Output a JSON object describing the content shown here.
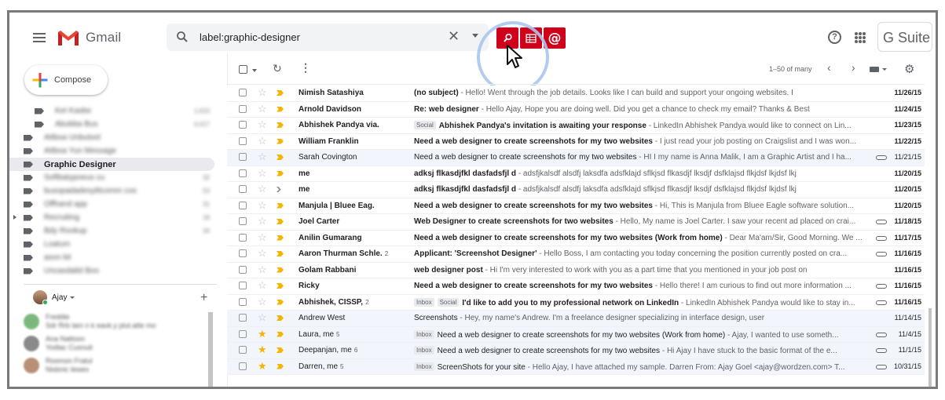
{
  "header": {
    "app_name": "Gmail",
    "search_query": "label:graphic-designer",
    "gsuite": "G Suite",
    "help": "?"
  },
  "sidebar": {
    "compose": "Compose",
    "labels": [
      {
        "name": "Ket Kasbe",
        "count": "1,610",
        "indent": 1
      },
      {
        "name": "Abubba Bus",
        "count": "4,417",
        "indent": 1
      },
      {
        "name": "Attboa Unbutool",
        "count": "",
        "indent": 0
      },
      {
        "name": "Attboa Yun Message",
        "count": "",
        "indent": 0
      },
      {
        "name": "Graphic Designer",
        "count": "",
        "indent": 0,
        "active": true
      },
      {
        "name": "Softbatypoeus cu",
        "count": "32",
        "indent": 0
      },
      {
        "name": "busopadadesylitcomm cos",
        "count": "53",
        "indent": 0
      },
      {
        "name": "Offhand app",
        "count": "31",
        "indent": 0
      },
      {
        "name": "Recruiting",
        "count": "18",
        "indent": 0,
        "expand": true
      },
      {
        "name": "Bdy Rookup",
        "count": "34",
        "indent": 0
      },
      {
        "name": "Loatum",
        "count": "",
        "indent": 0
      },
      {
        "name": "ason kit",
        "count": "",
        "indent": 0
      },
      {
        "name": "Uncasdalid Boo",
        "count": "",
        "indent": 0
      }
    ],
    "user": "Ajay",
    "hangouts": [
      {
        "l1": "Freddie",
        "l2": "Sdr Rrb lam n k eavk.y plut.atte mo",
        "color": "#7cb87e"
      },
      {
        "l1": "Ana Nattoon",
        "l2": "Yodlac Cusnuit",
        "color": "#8a8a8a"
      },
      {
        "l1": "Roomon Fratul",
        "l2": "Nisbnic lewes",
        "color": "#b89077"
      }
    ]
  },
  "toolbar": {
    "range": "1–50 of many"
  },
  "emails": [
    {
      "sender": "Nimish Satashiya",
      "n": "",
      "chips": [],
      "subject": "(no subject)",
      "preview": " - Hello! Went through the job details. Looks like I can build and support your ongoing websites. I",
      "date": "11/26/15",
      "unread": true,
      "starred": false,
      "important": true,
      "clip": false
    },
    {
      "sender": "Arnold Davidson",
      "n": "",
      "chips": [],
      "subject": "Re: web designer",
      "preview": " - Hello Ajay, Hope you are doing well. Did you get a chance to check my email? Thanks & Best",
      "date": "11/24/15",
      "unread": true,
      "starred": false,
      "important": true,
      "clip": false
    },
    {
      "sender": "Abhishek Pandya via.",
      "n": "",
      "chips": [
        "Social"
      ],
      "subject": "Abhishek Pandya's invitation is awaiting your response",
      "preview": " - LinkedIn Abhishek Pandya would like to connect on Lin...",
      "date": "11/23/15",
      "unread": true,
      "starred": false,
      "important": true,
      "clip": false
    },
    {
      "sender": "William Franklin",
      "n": "",
      "chips": [],
      "subject": "Need a web designer to create screenshots for my two websites",
      "preview": " - I just read your job posting on Craigslist and I was won...",
      "date": "11/22/15",
      "unread": true,
      "starred": false,
      "important": true,
      "clip": false
    },
    {
      "sender": "Sarah Covington",
      "n": "",
      "chips": [],
      "subject": "Need a web designer to create screenshots for my two websites",
      "preview": " - HI I my name is Anna Malik, I am a Graphic Artist and I ha...",
      "date": "11/21/15",
      "unread": false,
      "starred": false,
      "important": true,
      "clip": true
    },
    {
      "sender": "me",
      "n": "",
      "chips": [],
      "subject": "adksj flkasdjfkl dasfadsfjl d",
      "preview": " - adsfjkalsdf alsdfj laksdfa adsfklajd sflkjsd flkasdjf lksdjf dsfklajsd flkjdsf lkjdsf lkj",
      "date": "11/20/15",
      "unread": true,
      "starred": false,
      "important": true,
      "clip": false
    },
    {
      "sender": "me",
      "n": "",
      "chips": [],
      "subject": "adksj flkasdjfkl dasfadsfjl d",
      "preview": " - adsfjkalsdf alsdfj laksdfa adsfklajd sflkjsd flkasdjf lksdjf dsfklajsd flkjdsf lkjdsf lkj",
      "date": "11/20/15",
      "unread": true,
      "starred": false,
      "important": false,
      "clip": false
    },
    {
      "sender": "Manjula | Bluee Eag.",
      "n": "",
      "chips": [],
      "subject": "Need a web designer to create screenshots for my two websites",
      "preview": " - Hi, This is Manjula from Bluee Eagle software solution...",
      "date": "11/20/15",
      "unread": true,
      "starred": false,
      "important": true,
      "clip": false
    },
    {
      "sender": "Joel Carter",
      "n": "",
      "chips": [],
      "subject": "Web Designer to create screenshots for two websites",
      "preview": " - Hello, My name is Joel Carter. I saw your recent ad placed on crai...",
      "date": "11/18/15",
      "unread": true,
      "starred": false,
      "important": true,
      "clip": true
    },
    {
      "sender": "Anilin Gumarang",
      "n": "",
      "chips": [],
      "subject": "Need a web designer to create screenshots for my two websites (Work from home)",
      "preview": " - Dear Ma'am/Sir, Good Morning. We ...",
      "date": "11/17/15",
      "unread": true,
      "starred": false,
      "important": true,
      "clip": true
    },
    {
      "sender": "Aaron Thurman Schle.",
      "n": "2",
      "chips": [],
      "subject": "Applicant: 'Screenshot Designer'",
      "preview": " - Hello Boss, I am contacting you today concerning the position currently posted on cra...",
      "date": "11/16/15",
      "unread": true,
      "starred": false,
      "important": true,
      "clip": true
    },
    {
      "sender": "Golam Rabbani",
      "n": "",
      "chips": [],
      "subject": "web designer post",
      "preview": " - Hi I'm very interested to work with you as a part time that you mentioned in your job post on",
      "date": "11/16/15",
      "unread": true,
      "starred": false,
      "important": true,
      "clip": false
    },
    {
      "sender": "Ricky",
      "n": "",
      "chips": [],
      "subject": "Need a web designer to create screenshots for my two websites",
      "preview": " - Hello there! I am curious to find out more information ...",
      "date": "11/16/15",
      "unread": true,
      "starred": false,
      "important": true,
      "clip": true
    },
    {
      "sender": "Abhishek, CISSP,",
      "n": "2",
      "chips": [
        "Inbox",
        "Social"
      ],
      "subject": "I'd like to add you to my professional network on LinkedIn",
      "preview": " - LinkedIn Abhishek Pandya would like to stay in...",
      "date": "11/16/15",
      "unread": true,
      "starred": false,
      "important": true,
      "clip": true
    },
    {
      "sender": "Andrew West",
      "n": "",
      "chips": [],
      "subject": "Screenshots",
      "preview": " - Hey, my name's Andrew. I'm a freelance designer specializing in interface design, user",
      "date": "11/14/15",
      "unread": false,
      "starred": false,
      "important": true,
      "clip": false
    },
    {
      "sender": "Laura, me",
      "n": "5",
      "chips": [
        "Inbox"
      ],
      "subject": "Need a web designer to create screenshots for my two websites (Work from home)",
      "preview": " - Ajay, I wanted to use someth...",
      "date": "11/4/15",
      "unread": false,
      "starred": true,
      "important": true,
      "clip": true
    },
    {
      "sender": "Deepanjan, me",
      "n": "6",
      "chips": [
        "Inbox"
      ],
      "subject": "Need a web designer to create screenshots for my two websites",
      "preview": " - Hi Ajay I have stuck to the basic format of the e...",
      "date": "11/1/15",
      "unread": false,
      "starred": true,
      "important": true,
      "clip": true
    },
    {
      "sender": "Darren, me",
      "n": "5",
      "chips": [
        "Inbox"
      ],
      "subject": "ScreenShots for your site",
      "preview": " - Hello Ajay, I have attached my sample. Darren From: Ajay Goel <ajay@wordzen.com> T...",
      "date": "10/31/15",
      "unread": false,
      "starred": true,
      "important": true,
      "clip": true
    }
  ],
  "colors": {
    "accent_red": "#d0021b",
    "star": "#f4b400",
    "important": "#f4b400",
    "highlight_ring": "#a9c6ee"
  }
}
